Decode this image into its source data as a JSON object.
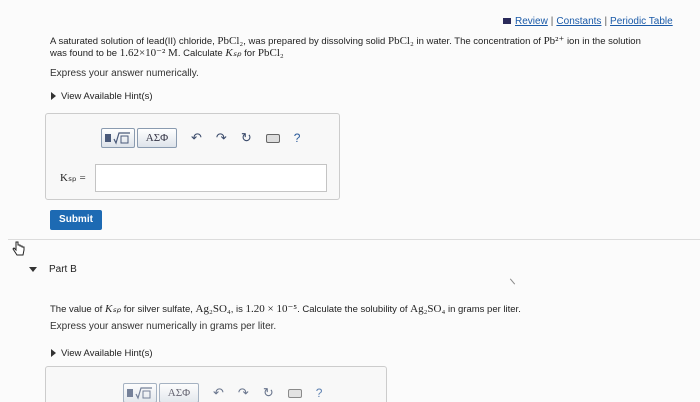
{
  "header": {
    "review": "Review",
    "constants": "Constants",
    "periodic_table": "Periodic Table",
    "separator": "|"
  },
  "partA": {
    "q1_a": "A saturated solution of lead(II) chloride,",
    "q1_formula": "PbCl₂",
    "q1_b": ", was prepared by dissolving solid",
    "q1_formula2": "PbCl₂",
    "q1_c": "in water. The concentration of",
    "q1_ion": "Pb²⁺",
    "q1_d": "ion in the solution",
    "q2_a": "was found to be",
    "q2_conc": "1.62×10⁻² M",
    "q2_b": ". Calculate",
    "q2_k": "Kₛₚ",
    "q2_c": "for",
    "q2_formula": "PbCl₂",
    "instruction": "Express your answer numerically.",
    "hint": "View Available Hint(s)",
    "ksp_label": "Kₛₚ =",
    "answer_value": "",
    "submit": "Submit"
  },
  "toolbar": {
    "greek": "ΑΣΦ",
    "help": "?"
  },
  "partB": {
    "title": "Part B",
    "q_a": "The value of",
    "q_k": "Kₛₚ",
    "q_b": "for silver sulfate,",
    "q_formula": "Ag₂SO₄",
    "q_c": ", is",
    "q_value": "1.20 × 10⁻⁵",
    "q_d": ". Calculate the solubility of",
    "q_formula2": "Ag₂SO₄",
    "q_e": "in grams per liter.",
    "instruction": "Express your answer numerically in grams per liter.",
    "hint": "View Available Hint(s)"
  }
}
